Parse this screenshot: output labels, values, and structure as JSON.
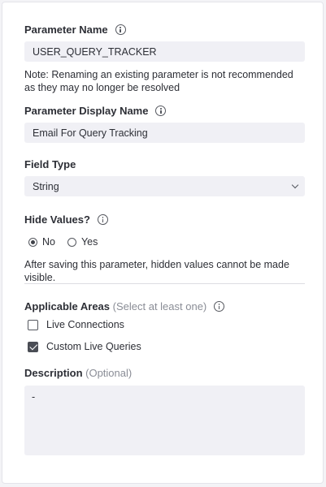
{
  "param_name": {
    "label": "Parameter Name",
    "value": "USER_QUERY_TRACKER",
    "note": "Note: Renaming an existing parameter is not recommended as they may no longer be resolved"
  },
  "display_name": {
    "label": "Parameter Display Name",
    "value": "Email For Query Tracking"
  },
  "field_type": {
    "label": "Field Type",
    "selected": "String"
  },
  "hide_values": {
    "label": "Hide Values?",
    "options": [
      "No",
      "Yes"
    ],
    "selected": "No",
    "note": "After saving this parameter, hidden values cannot be made visible."
  },
  "applicable_areas": {
    "label": "Applicable Areas",
    "hint": "(Select at least one)",
    "options": [
      {
        "label": "Live Connections",
        "checked": false
      },
      {
        "label": "Custom Live Queries",
        "checked": true
      }
    ]
  },
  "description": {
    "label": "Description",
    "hint": "(Optional)",
    "value": "-"
  }
}
